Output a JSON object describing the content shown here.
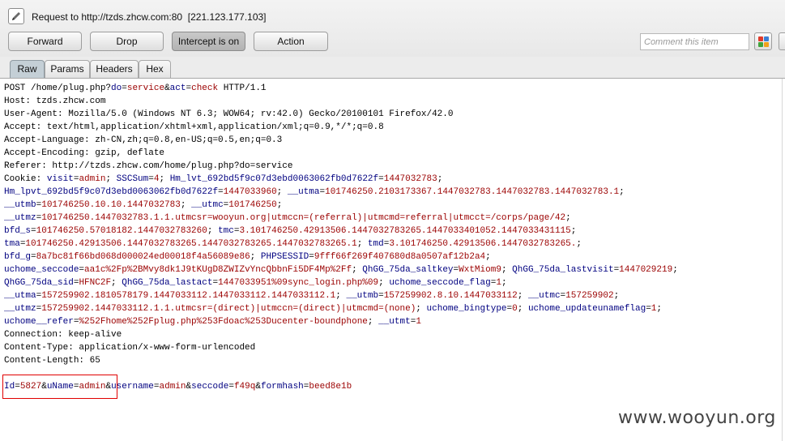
{
  "header": {
    "request_title": "Request to http://tzds.zhcw.com:80  [221.123.177.103]"
  },
  "toolbar": {
    "forward_label": "Forward",
    "drop_label": "Drop",
    "intercept_label": "Intercept is on",
    "action_label": "Action",
    "comment_placeholder": "Comment this item"
  },
  "tabs": [
    "Raw",
    "Params",
    "Headers",
    "Hex"
  ],
  "active_tab": "Raw",
  "colors": {
    "header_name": "#000000",
    "param_name": "#000080",
    "param_value": "#9b0000",
    "highlight_box": "#e00000"
  },
  "request_lines": [
    [
      [
        "k",
        "POST /home/plug.php?"
      ],
      [
        "n",
        "do"
      ],
      [
        "k",
        "="
      ],
      [
        "v",
        "service"
      ],
      [
        "k",
        "&"
      ],
      [
        "n",
        "act"
      ],
      [
        "k",
        "="
      ],
      [
        "v",
        "check"
      ],
      [
        "k",
        " HTTP/1.1"
      ]
    ],
    [
      [
        "k",
        "Host: tzds.zhcw.com"
      ]
    ],
    [
      [
        "k",
        "User-Agent: Mozilla/5.0 (Windows NT 6.3; WOW64; rv:42.0) Gecko/20100101 Firefox/42.0"
      ]
    ],
    [
      [
        "k",
        "Accept: text/html,application/xhtml+xml,application/xml;q=0.9,*/*;q=0.8"
      ]
    ],
    [
      [
        "k",
        "Accept-Language: zh-CN,zh;q=0.8,en-US;q=0.5,en;q=0.3"
      ]
    ],
    [
      [
        "k",
        "Accept-Encoding: gzip, deflate"
      ]
    ],
    [
      [
        "k",
        "Referer: http://tzds.zhcw.com/home/plug.php?do=service"
      ]
    ],
    [
      [
        "k",
        "Cookie: "
      ],
      [
        "n",
        "visit"
      ],
      [
        "k",
        "="
      ],
      [
        "v",
        "admin"
      ],
      [
        "k",
        "; "
      ],
      [
        "n",
        "SSCSum"
      ],
      [
        "k",
        "="
      ],
      [
        "v",
        "4"
      ],
      [
        "k",
        "; "
      ],
      [
        "n",
        "Hm_lvt_692bd5f9c07d3ebd0063062fb0d7622f"
      ],
      [
        "k",
        "="
      ],
      [
        "v",
        "1447032783"
      ],
      [
        "k",
        ";"
      ]
    ],
    [
      [
        "n",
        "Hm_lpvt_692bd5f9c07d3ebd0063062fb0d7622f"
      ],
      [
        "k",
        "="
      ],
      [
        "v",
        "1447033960"
      ],
      [
        "k",
        "; "
      ],
      [
        "n",
        "__utma"
      ],
      [
        "k",
        "="
      ],
      [
        "v",
        "101746250.2103173367.1447032783.1447032783.1447032783.1"
      ],
      [
        "k",
        ";"
      ]
    ],
    [
      [
        "n",
        "__utmb"
      ],
      [
        "k",
        "="
      ],
      [
        "v",
        "101746250.10.10.1447032783"
      ],
      [
        "k",
        "; "
      ],
      [
        "n",
        "__utmc"
      ],
      [
        "k",
        "="
      ],
      [
        "v",
        "101746250"
      ],
      [
        "k",
        ";"
      ]
    ],
    [
      [
        "n",
        "__utmz"
      ],
      [
        "k",
        "="
      ],
      [
        "v",
        "101746250.1447032783.1.1.utmcsr=wooyun.org|utmccn=(referral)|utmcmd=referral|utmcct=/corps/page/42"
      ],
      [
        "k",
        ";"
      ]
    ],
    [
      [
        "n",
        "bfd_s"
      ],
      [
        "k",
        "="
      ],
      [
        "v",
        "101746250.57018182.1447032783260"
      ],
      [
        "k",
        "; "
      ],
      [
        "n",
        "tmc"
      ],
      [
        "k",
        "="
      ],
      [
        "v",
        "3.101746250.42913506.1447032783265.1447033401052.1447033431115"
      ],
      [
        "k",
        ";"
      ]
    ],
    [
      [
        "n",
        "tma"
      ],
      [
        "k",
        "="
      ],
      [
        "v",
        "101746250.42913506.1447032783265.1447032783265.1447032783265.1"
      ],
      [
        "k",
        "; "
      ],
      [
        "n",
        "tmd"
      ],
      [
        "k",
        "="
      ],
      [
        "v",
        "3.101746250.42913506.1447032783265."
      ],
      [
        "k",
        ";"
      ]
    ],
    [
      [
        "n",
        "bfd_g"
      ],
      [
        "k",
        "="
      ],
      [
        "v",
        "8a7bc81f66bd068d000024ed00018f4a56089e86"
      ],
      [
        "k",
        "; "
      ],
      [
        "n",
        "PHPSESSID"
      ],
      [
        "k",
        "="
      ],
      [
        "v",
        "9fff66f269f407680d8a0507af12b2a4"
      ],
      [
        "k",
        ";"
      ]
    ],
    [
      [
        "n",
        "uchome_seccode"
      ],
      [
        "k",
        "="
      ],
      [
        "v",
        "aa1c%2Fp%2BMvy8dk1J9tKUgD8ZWIZvYncQbbnFi5DF4Mp%2Ff"
      ],
      [
        "k",
        "; "
      ],
      [
        "n",
        "QhGG_75da_saltkey"
      ],
      [
        "k",
        "="
      ],
      [
        "v",
        "WxtMiom9"
      ],
      [
        "k",
        "; "
      ],
      [
        "n",
        "QhGG_75da_lastvisit"
      ],
      [
        "k",
        "="
      ],
      [
        "v",
        "1447029219"
      ],
      [
        "k",
        ";"
      ]
    ],
    [
      [
        "n",
        "QhGG_75da_sid"
      ],
      [
        "k",
        "="
      ],
      [
        "v",
        "HFNC2F"
      ],
      [
        "k",
        "; "
      ],
      [
        "n",
        "QhGG_75da_lastact"
      ],
      [
        "k",
        "="
      ],
      [
        "v",
        "1447033951%09sync_login.php%09"
      ],
      [
        "k",
        "; "
      ],
      [
        "n",
        "uchome_seccode_flag"
      ],
      [
        "k",
        "="
      ],
      [
        "v",
        "1"
      ],
      [
        "k",
        ";"
      ]
    ],
    [
      [
        "n",
        "__utma"
      ],
      [
        "k",
        "="
      ],
      [
        "v",
        "157259902.1810578179.1447033112.1447033112.1447033112.1"
      ],
      [
        "k",
        "; "
      ],
      [
        "n",
        "__utmb"
      ],
      [
        "k",
        "="
      ],
      [
        "v",
        "157259902.8.10.1447033112"
      ],
      [
        "k",
        "; "
      ],
      [
        "n",
        "__utmc"
      ],
      [
        "k",
        "="
      ],
      [
        "v",
        "157259902"
      ],
      [
        "k",
        ";"
      ]
    ],
    [
      [
        "n",
        "__utmz"
      ],
      [
        "k",
        "="
      ],
      [
        "v",
        "157259902.1447033112.1.1.utmcsr=(direct)|utmccn=(direct)|utmcmd=(none)"
      ],
      [
        "k",
        "; "
      ],
      [
        "n",
        "uchome_bingtype"
      ],
      [
        "k",
        "="
      ],
      [
        "v",
        "0"
      ],
      [
        "k",
        "; "
      ],
      [
        "n",
        "uchome_updateunameflag"
      ],
      [
        "k",
        "="
      ],
      [
        "v",
        "1"
      ],
      [
        "k",
        ";"
      ]
    ],
    [
      [
        "n",
        "uchome__refer"
      ],
      [
        "k",
        "="
      ],
      [
        "v",
        "%252Fhome%252Fplug.php%253Fdoac%253Ducenter-boundphone"
      ],
      [
        "k",
        "; "
      ],
      [
        "n",
        "__utmt"
      ],
      [
        "k",
        "="
      ],
      [
        "v",
        "1"
      ]
    ],
    [
      [
        "k",
        "Connection: keep-alive"
      ]
    ],
    [
      [
        "k",
        "Content-Type: application/x-www-form-urlencoded"
      ]
    ],
    [
      [
        "k",
        "Content-Length: 65"
      ]
    ],
    [],
    [
      [
        "n",
        "Id"
      ],
      [
        "k",
        "="
      ],
      [
        "v",
        "5827"
      ],
      [
        "k",
        "&"
      ],
      [
        "n",
        "uName"
      ],
      [
        "k",
        "="
      ],
      [
        "v",
        "admin"
      ],
      [
        "k",
        "&"
      ],
      [
        "n",
        "username"
      ],
      [
        "k",
        "="
      ],
      [
        "v",
        "admin"
      ],
      [
        "k",
        "&"
      ],
      [
        "n",
        "seccode"
      ],
      [
        "k",
        "="
      ],
      [
        "v",
        "f49q"
      ],
      [
        "k",
        "&"
      ],
      [
        "n",
        "formhash"
      ],
      [
        "k",
        "="
      ],
      [
        "v",
        "beed8e1b"
      ]
    ]
  ],
  "watermark": "www.wooyun.org"
}
